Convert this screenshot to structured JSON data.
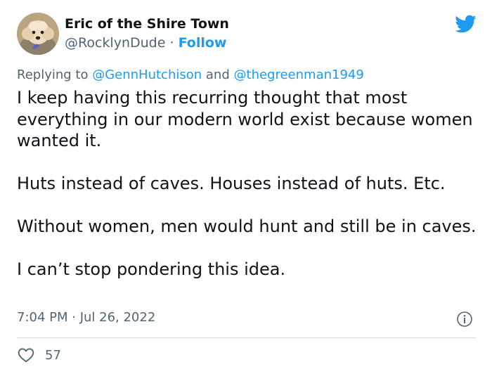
{
  "author": {
    "display_name": "Eric of the Shire Town",
    "handle": "@RocklynDude",
    "separator": "·",
    "follow_label": "Follow"
  },
  "reply": {
    "prefix": "Replying to",
    "mention_1": "@GennHutchison",
    "conjunction": "and",
    "mention_2": "@thegreenman1949"
  },
  "tweet": {
    "paragraphs": [
      "I keep having this recurring thought that most everything in our modern world exist because women wanted it.",
      "Huts instead of caves. Houses instead of huts. Etc.",
      "Without women, men would hunt and still be in caves.",
      "I can’t stop pondering this idea."
    ],
    "timestamp": "7:04 PM · Jul 26, 2022"
  },
  "engagement": {
    "likes": "57"
  },
  "icons": {
    "logo": "twitter-bird-icon",
    "info": "info-icon",
    "like": "heart-icon"
  },
  "colors": {
    "brand": "#1d9bf0",
    "text": "#0f1419",
    "muted": "#536471",
    "divider": "#cfd9de"
  }
}
